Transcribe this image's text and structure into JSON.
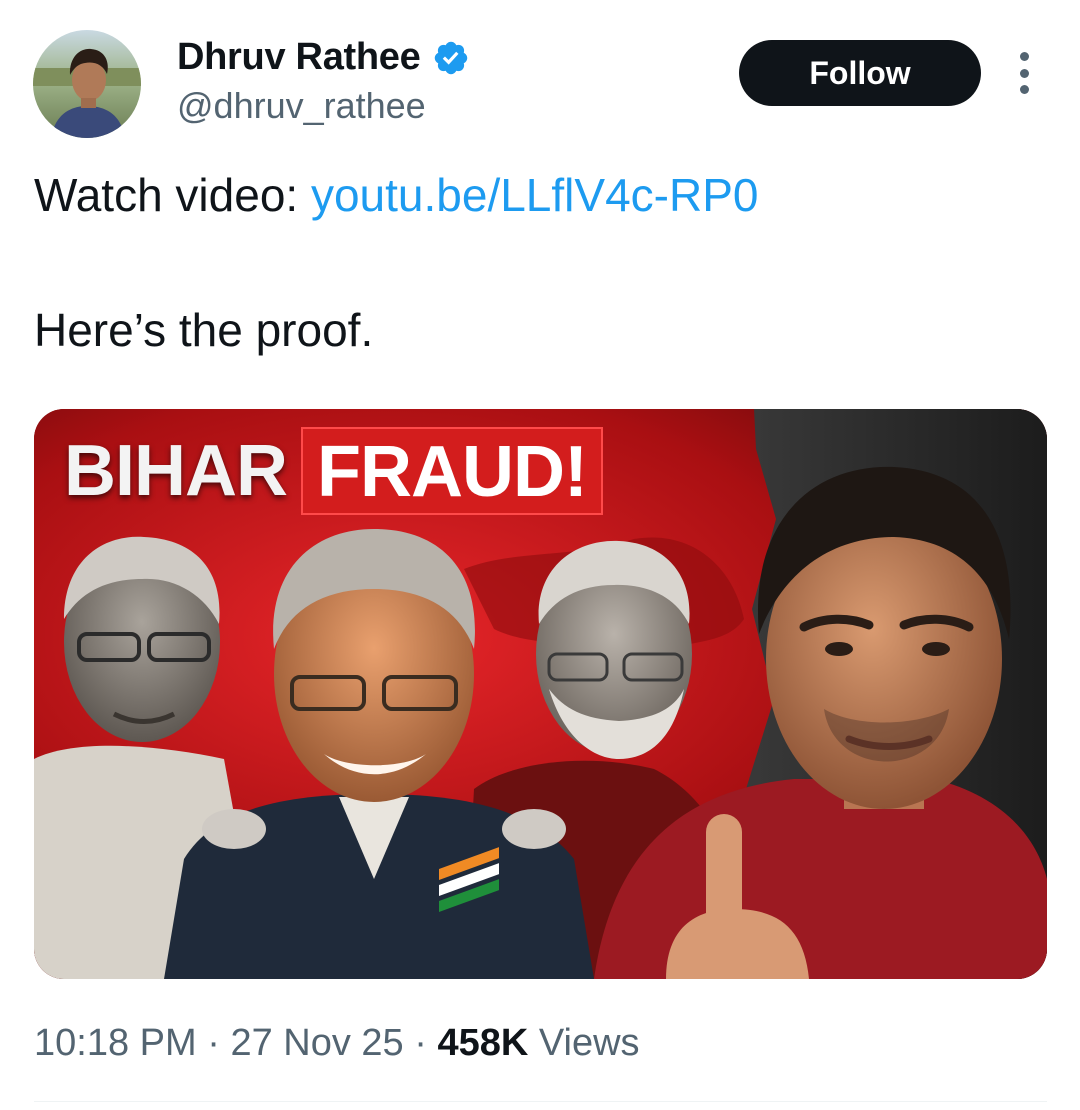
{
  "author": {
    "name": "Dhruv Rathee",
    "handle": "@dhruv_rathee",
    "verified_color": "#1d9bf0"
  },
  "header": {
    "follow_label": "Follow",
    "more_icon": "more-vertical-icon"
  },
  "body": {
    "watch_prefix": "Watch video: ",
    "link_text": "youtu.be/LLflV4c-RP0",
    "line2": "Here’s the proof."
  },
  "media": {
    "title_word1": "BIHAR",
    "title_word2": "FRAUD!"
  },
  "meta": {
    "time": "10:18 PM",
    "sep1": " · ",
    "date": "27 Nov 25",
    "sep2": " · ",
    "views_count": "458K",
    "views_label": " Views"
  },
  "colors": {
    "text": "#0f1419",
    "secondary": "#536471",
    "link": "#1d9bf0",
    "button_bg": "#0f1419",
    "thumb_red": "#c91a1a"
  }
}
